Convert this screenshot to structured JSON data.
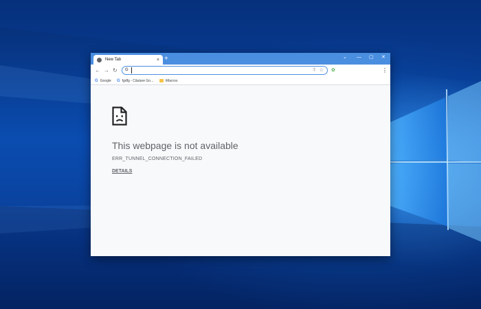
{
  "tab": {
    "label": "New Tab",
    "close": "×",
    "new_tab": "+"
  },
  "window_controls": {
    "minimize": "⌄",
    "minimize2": "—",
    "restore": "▢",
    "close": "✕"
  },
  "toolbar": {
    "back": "←",
    "forward": "→",
    "reload": "↻",
    "omnibox_value": "",
    "omnibox_search_glyph": "G",
    "share_glyph": "⇪",
    "star_glyph": "☆",
    "extension_glyph": "✿",
    "menu_glyph": "⋮"
  },
  "bookmarks": [
    {
      "label": "Google",
      "icon": "google-icon"
    },
    {
      "label": "fgdfg - Căutare Go...",
      "icon": "google-icon"
    },
    {
      "label": "iMacros",
      "icon": "folder-icon"
    }
  ],
  "error": {
    "title": "This webpage is not available",
    "code": "ERR_TUNNEL_CONNECTION_FAILED",
    "details": "DETAILS"
  },
  "colors": {
    "titlebar": "#4a8ee0",
    "page_bg": "#f8f9fa",
    "text": "#5f6368",
    "desktop": "#0a4cb0"
  }
}
